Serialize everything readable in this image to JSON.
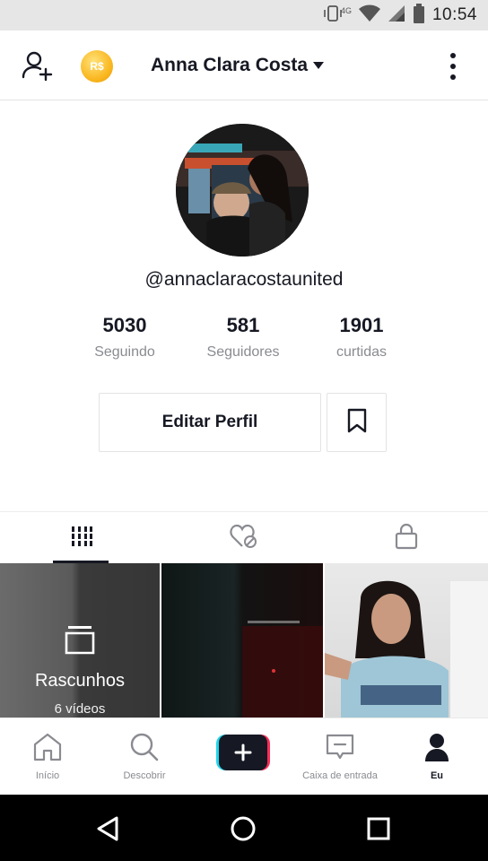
{
  "status_bar": {
    "time": "10:54",
    "network_label": "4G",
    "icons": [
      "vibrate-icon",
      "wifi-icon",
      "cell-signal-icon",
      "battery-icon"
    ]
  },
  "header": {
    "title": "Anna Clara Costa",
    "coin_label": "R$",
    "icons": [
      "add-user-icon",
      "coin-icon",
      "caret-down-icon",
      "more-vertical-icon"
    ]
  },
  "profile": {
    "username": "@annaclaracostaunited",
    "stats": [
      {
        "value": "5030",
        "label": "Seguindo"
      },
      {
        "value": "581",
        "label": "Seguidores"
      },
      {
        "value": "1901",
        "label": "curtidas"
      }
    ],
    "edit_button": "Editar Perfil",
    "bookmark_icon": "bookmark-icon"
  },
  "tabs": {
    "items": [
      "grid-icon",
      "liked-hidden-icon",
      "lock-icon"
    ],
    "active_index": 0
  },
  "grid": {
    "drafts_label": "Rascunhos",
    "drafts_count": "6 vídeos"
  },
  "bottom_nav": {
    "items": [
      {
        "label": "Início",
        "icon": "home-icon"
      },
      {
        "label": "Descobrir",
        "icon": "search-icon"
      },
      {
        "label": "",
        "icon": "plus-icon"
      },
      {
        "label": "Caixa de entrada",
        "icon": "inbox-icon"
      },
      {
        "label": "Eu",
        "icon": "profile-icon"
      }
    ],
    "active_index": 4
  },
  "colors": {
    "text_primary": "#161823",
    "text_secondary": "#8a8b91",
    "brand_red": "#fe2c55",
    "brand_cyan": "#20d5ec",
    "coin_gold": "#f9b51c"
  }
}
